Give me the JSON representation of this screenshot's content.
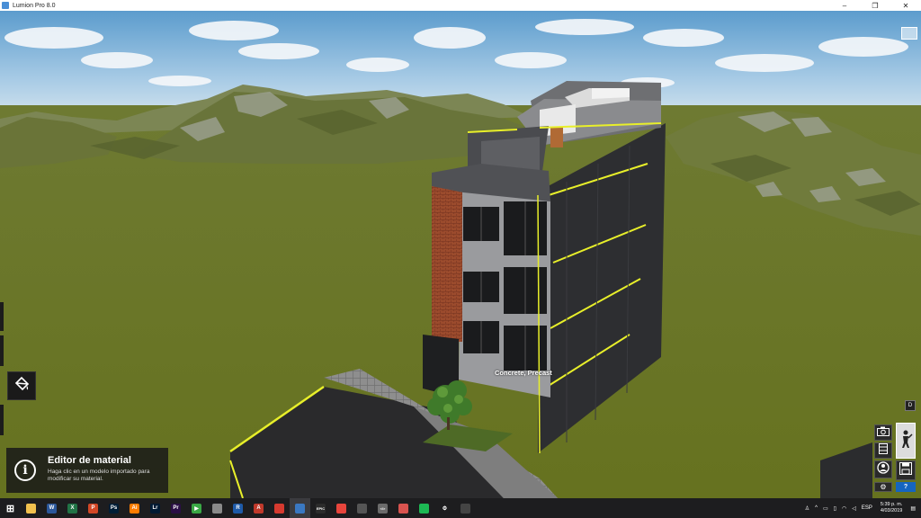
{
  "window": {
    "title": "Lumion Pro 8.0",
    "controls": [
      "–",
      "❐",
      "✕"
    ]
  },
  "viewport": {
    "hover_material_label": "Concrete, Precast"
  },
  "info_panel": {
    "title": "Editor de material",
    "description": "Haga clic en un modelo importado para modificar su material."
  },
  "right_panel": {
    "small_button_label": "D",
    "help_label": "?"
  },
  "taskbar": {
    "apps": [
      {
        "name": "windows-start-icon",
        "color": "#1d1d1f",
        "glyph": "⊞"
      },
      {
        "name": "file-explorer-icon",
        "color": "#f2c14e",
        "glyph": ""
      },
      {
        "name": "word-icon",
        "color": "#2b579a",
        "glyph": "W"
      },
      {
        "name": "excel-icon",
        "color": "#217346",
        "glyph": "X"
      },
      {
        "name": "powerpoint-icon",
        "color": "#d24726",
        "glyph": "P"
      },
      {
        "name": "photoshop-icon",
        "color": "#001e36",
        "glyph": "Ps"
      },
      {
        "name": "illustrator-icon",
        "color": "#ff7c00",
        "glyph": "Ai"
      },
      {
        "name": "lightroom-icon",
        "color": "#001a33",
        "glyph": "Lr"
      },
      {
        "name": "premiere-icon",
        "color": "#2a0f45",
        "glyph": "Pr"
      },
      {
        "name": "media-player-icon",
        "color": "#3aa845",
        "glyph": "▶"
      },
      {
        "name": "printer-icon",
        "color": "#8a8a8a",
        "glyph": ""
      },
      {
        "name": "revit-icon",
        "color": "#1e5aa8",
        "glyph": "R"
      },
      {
        "name": "autocad-icon",
        "color": "#c0392b",
        "glyph": "A"
      },
      {
        "name": "sketchup-icon",
        "color": "#d63a2f",
        "glyph": ""
      },
      {
        "name": "lumion-icon",
        "color": "#3a78c2",
        "glyph": ""
      },
      {
        "name": "epic-games-icon",
        "color": "#2b2b2b",
        "glyph": "EPIC"
      },
      {
        "name": "chrome-icon",
        "color": "#e8453c",
        "glyph": ""
      },
      {
        "name": "app-icon-grey",
        "color": "#555555",
        "glyph": ""
      },
      {
        "name": "code-icon",
        "color": "#6b6b6b",
        "glyph": "</>"
      },
      {
        "name": "popcorn-icon",
        "color": "#d9534f",
        "glyph": ""
      },
      {
        "name": "spotify-icon",
        "color": "#1db954",
        "glyph": ""
      },
      {
        "name": "settings-icon",
        "color": "#1d1d1f",
        "glyph": "⚙"
      },
      {
        "name": "calculator-icon",
        "color": "#444444",
        "glyph": ""
      }
    ],
    "active_app_index": 14,
    "tray_language": "ESP",
    "time": "5:39 p. m.",
    "date": "4/03/2019"
  },
  "colors": {
    "sky_top": "#5e9fd0",
    "grass": "#6f7a2e",
    "building_dark": "#2c2d30",
    "highlight_yellow": "#e8ef2a",
    "brick": "#9a4a2e"
  }
}
